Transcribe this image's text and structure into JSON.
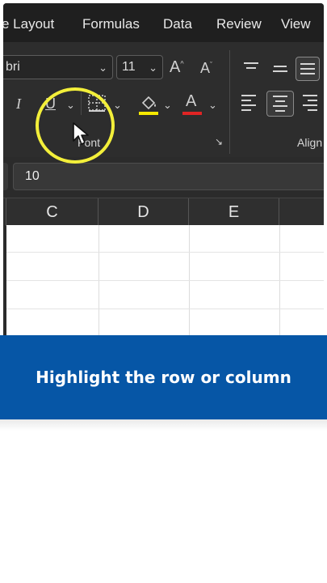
{
  "tabs": [
    "e Layout",
    "Formulas",
    "Data",
    "Review",
    "View"
  ],
  "font": {
    "name": "bri",
    "size": "11",
    "grow_label": "A",
    "shrink_label": "A",
    "italic_label": "I",
    "underline_label": "U",
    "font_color_label": "A",
    "group_label": "Font"
  },
  "alignment": {
    "group_label": "Align"
  },
  "formula_bar": {
    "value": "10"
  },
  "columns": [
    "C",
    "D",
    "E"
  ],
  "banner": {
    "text": "Highlight the row or column"
  },
  "colors": {
    "highlight_ring": "#f3ef3a",
    "fill_color": "#f5e800",
    "font_color": "#e02424",
    "banner_bg": "#0656a6"
  },
  "icons": [
    "italic-icon",
    "underline-icon",
    "borders-icon",
    "fill-color-icon",
    "font-color-icon",
    "align-top-icon",
    "align-middle-icon",
    "align-bottom-icon",
    "align-left-icon",
    "align-center-icon",
    "align-right-icon",
    "dialog-launcher-icon",
    "mouse-cursor-icon"
  ]
}
